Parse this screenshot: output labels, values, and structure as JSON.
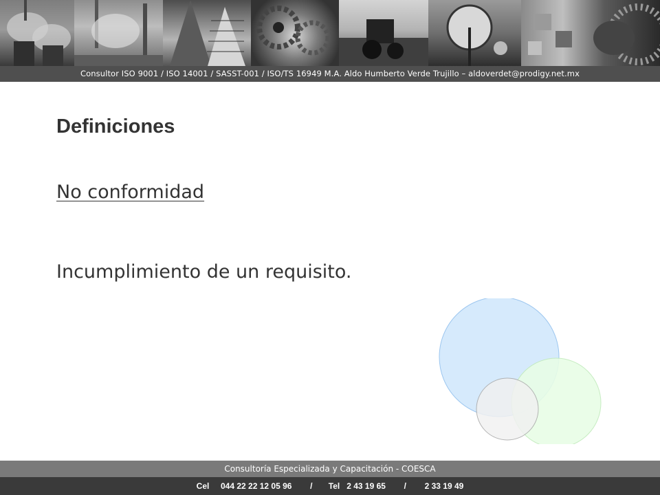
{
  "header": {
    "banner_text": "Consultor ISO 9001 / ISO 14001 / SASST-001 / ISO/TS 16949 M.A. Aldo Humberto Verde Trujillo  – aldoverdet@prodigy.net.mx"
  },
  "content": {
    "title": "Definiciones",
    "subtitle": "No conformidad",
    "definition": "Incumplimiento de un requisito."
  },
  "footer": {
    "company": "Consultoría Especializada y Capacitación - COESCA",
    "contact": "Cel     044 22 22 12 05 96        /       Tel   2 43 19 65        /        2 33 19 49"
  },
  "colors": {
    "header_bar": "#4f4f4f",
    "footer_top": "#7a7a7a",
    "footer_bottom": "#3a3a3a",
    "circle_blue": "#d6eafc",
    "circle_green": "#e8fde6",
    "circle_gray": "#f1f1f1"
  }
}
